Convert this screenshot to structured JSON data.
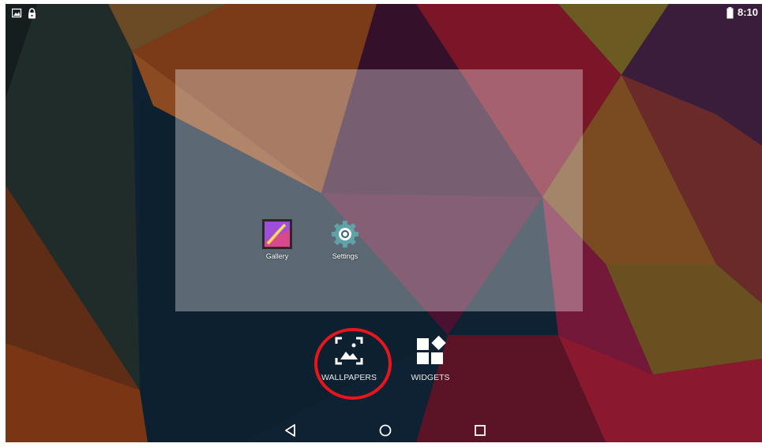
{
  "status_bar": {
    "left_icons": [
      "screenshot-notification-icon",
      "lock-icon"
    ],
    "battery_icon": "battery-icon",
    "time": "8:10"
  },
  "home_preview": {
    "apps": [
      {
        "label": "Gallery",
        "icon": "gallery-icon"
      },
      {
        "label": "Settings",
        "icon": "gear-icon"
      }
    ]
  },
  "overview_options": {
    "wallpapers": {
      "label": "WALLPAPERS",
      "icon": "wallpaper-icon",
      "highlighted": true
    },
    "widgets": {
      "label": "WIDGETS",
      "icon": "widgets-icon"
    }
  },
  "navigation_bar": {
    "buttons": [
      "back-icon",
      "home-icon",
      "recents-icon"
    ]
  },
  "colors": {
    "highlight_ring": "#e8161c",
    "wallpaper_base": "#0f2233"
  }
}
